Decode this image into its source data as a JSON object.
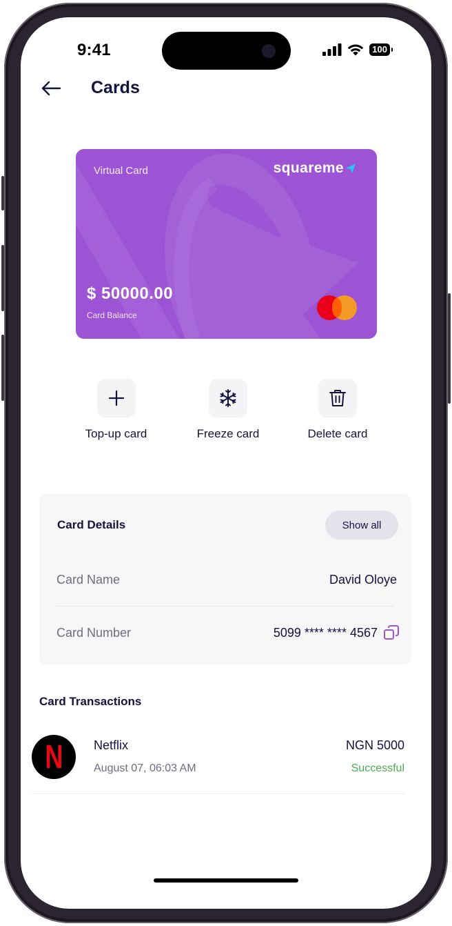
{
  "status_bar": {
    "time": "9:41",
    "battery": "100"
  },
  "header": {
    "title": "Cards"
  },
  "card": {
    "type_label": "Virtual Card",
    "brand": "squareme",
    "balance": "$ 50000.00",
    "balance_label": "Card Balance",
    "color": "#9c54d5"
  },
  "actions": [
    {
      "label": "Top-up card",
      "icon": "plus-icon"
    },
    {
      "label": "Freeze card",
      "icon": "snowflake-icon"
    },
    {
      "label": "Delete card",
      "icon": "trash-icon"
    }
  ],
  "details": {
    "title": "Card Details",
    "show_all": "Show all",
    "rows": [
      {
        "label": "Card Name",
        "value": "David Oloye"
      },
      {
        "label": "Card Number",
        "value": "5099 **** **** 4567"
      }
    ]
  },
  "transactions": {
    "title": "Card Transactions",
    "items": [
      {
        "merchant": "Netflix",
        "logo_letter": "N",
        "date": "August 07, 06:03 AM",
        "amount": "NGN 5000",
        "status": "Successful",
        "status_color": "#4caf50"
      }
    ]
  }
}
